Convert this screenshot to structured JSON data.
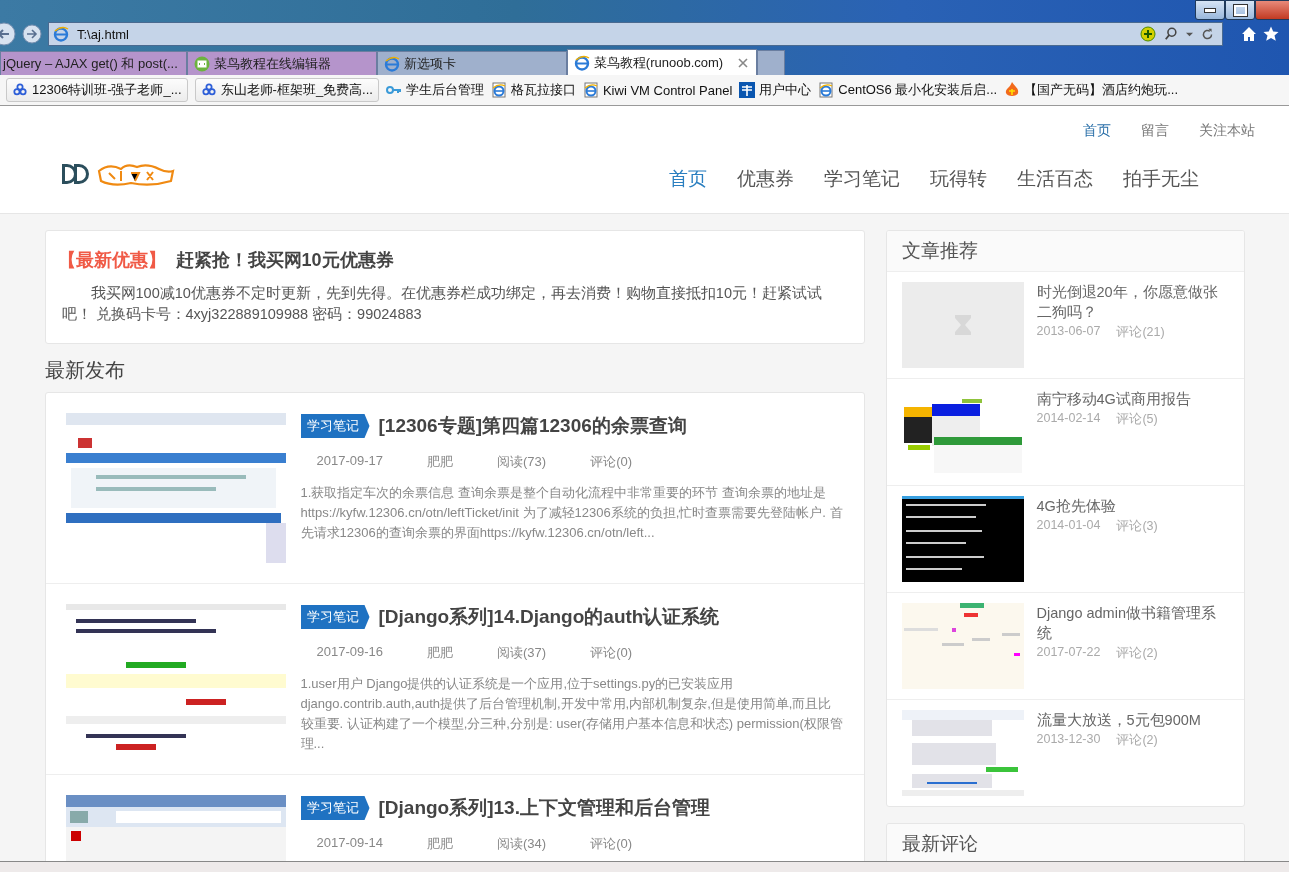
{
  "browser": {
    "address": "T:\\aj.html",
    "tabs": [
      {
        "label": "jQuery – AJAX get() 和 post(...",
        "kind": "plain",
        "color": "#b594cb",
        "selected": false
      },
      {
        "label": "菜鸟教程在线编辑器",
        "kind": "editor",
        "color": "#b594cb",
        "selected": false
      },
      {
        "label": "新选项卡",
        "kind": "ie",
        "color": "#9fb0cc",
        "selected": false
      },
      {
        "label": "菜鸟教程(runoob.com)",
        "kind": "ie",
        "color": "#ffffff",
        "selected": true
      }
    ],
    "bookmarks": [
      {
        "label": "12306特训班-强子老师_...",
        "kind": "cloud",
        "boxed": true
      },
      {
        "label": "东山老师-框架班_免费高...",
        "kind": "cloud",
        "boxed": true
      },
      {
        "label": "学生后台管理",
        "kind": "key",
        "boxed": false
      },
      {
        "label": "格瓦拉接口",
        "kind": "ie",
        "boxed": false
      },
      {
        "label": "Kiwi VM Control Panel",
        "kind": "ie",
        "boxed": false
      },
      {
        "label": "用户中心",
        "kind": "telecom",
        "boxed": false
      },
      {
        "label": "CentOS6 最小化安装后启...",
        "kind": "ie",
        "boxed": false
      },
      {
        "label": "【国产无码】酒店约炮玩...",
        "kind": "fire",
        "boxed": false
      }
    ]
  },
  "site": {
    "top_links": [
      {
        "label": "首页",
        "selected": true
      },
      {
        "label": "留言",
        "selected": false
      },
      {
        "label": "关注本站",
        "selected": false
      }
    ],
    "nav": [
      {
        "label": "首页",
        "selected": true
      },
      {
        "label": "优惠券",
        "selected": false
      },
      {
        "label": "学习笔记",
        "selected": false
      },
      {
        "label": "玩得转",
        "selected": false
      },
      {
        "label": "生活百态",
        "selected": false
      },
      {
        "label": "拍手无尘",
        "selected": false
      }
    ]
  },
  "promo": {
    "tag": "【最新优惠】",
    "title": "赶紧抢！我买网10元优惠券",
    "body": "我买网100减10优惠券不定时更新，先到先得。在优惠券栏成功绑定，再去消费！购物直接抵扣10元！赶紧试试吧！ 兑换码卡号：4xyj322889109988 密码：99024883"
  },
  "latest": {
    "title": "最新发布",
    "articles": [
      {
        "category": "学习笔记",
        "title": "[12306专题]第四篇12306的余票查询",
        "date": "2017-09-17",
        "author": "肥肥",
        "reads": "阅读(73)",
        "comments": "评论(0)",
        "excerpt": "1.获取指定车次的余票信息 查询余票是整个自动化流程中非常重要的环节 查询余票的地址是https://kyfw.12306.cn/otn/leftTicket/init 为了减轻12306系统的负担,忙时查票需要先登陆帐户. 首先请求12306的查询余票的界面https://kyfw.12306.cn/otn/left..."
      },
      {
        "category": "学习笔记",
        "title": "[Django系列]14.Django的auth认证系统",
        "date": "2017-09-16",
        "author": "肥肥",
        "reads": "阅读(37)",
        "comments": "评论(0)",
        "excerpt": "1.user用户 Django提供的认证系统是一个应用,位于settings.py的已安装应用django.contrib.auth,auth提供了后台管理机制,开发中常用,内部机制复杂,但是使用简单,而且比较重要. 认证构建了一个模型,分三种,分别是: user(存储用户基本信息和状态) permission(权限管理..."
      },
      {
        "category": "学习笔记",
        "title": "[Django系列]13.上下文管理和后台管理",
        "date": "2017-09-14",
        "author": "肥肥",
        "reads": "阅读(34)",
        "comments": "评论(0)"
      }
    ]
  },
  "recommend": {
    "title": "文章推荐",
    "items": [
      {
        "title": "时光倒退20年，你愿意做张二狗吗？",
        "date": "2013-06-07",
        "comments": "评论(21)",
        "kind": "placeholder"
      },
      {
        "title": "南宁移动4G试商用报告",
        "date": "2014-02-14",
        "comments": "评论(5)",
        "kind": "picture"
      },
      {
        "title": "4G抢先体验",
        "date": "2014-01-04",
        "comments": "评论(3)",
        "kind": "picture"
      },
      {
        "title": "Django admin做书籍管理系统",
        "date": "2017-07-22",
        "comments": "评论(2)",
        "kind": "picture"
      },
      {
        "title": "流量大放送，5元包900M",
        "date": "2013-12-30",
        "comments": "评论(2)",
        "kind": "picture"
      }
    ]
  },
  "comments_panel": {
    "title": "最新评论"
  }
}
